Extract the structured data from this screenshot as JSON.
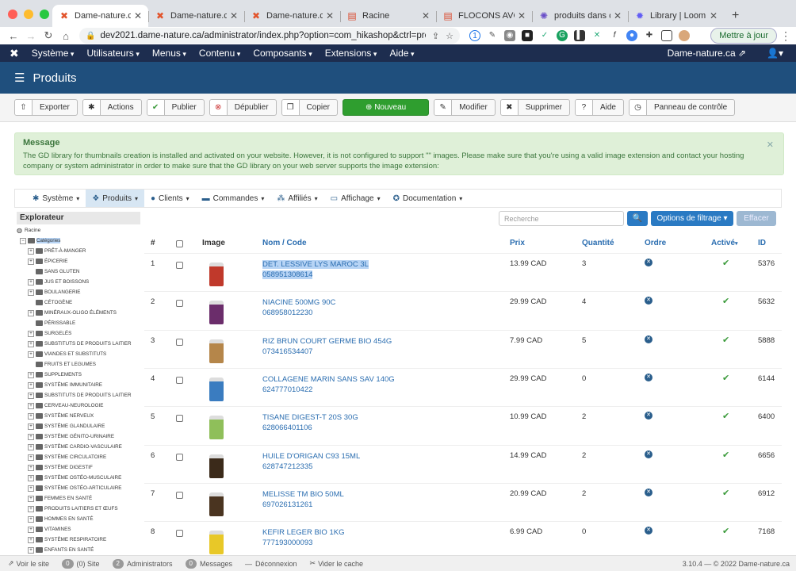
{
  "browser": {
    "tabs": [
      {
        "label": "Dame-nature.ca -",
        "icon": "joomla-icon",
        "active": true
      },
      {
        "label": "Dame-nature.ca -",
        "icon": "joomla-icon",
        "active": false
      },
      {
        "label": "Dame-nature.ca -",
        "icon": "joomla-icon",
        "active": false
      },
      {
        "label": "Racine",
        "icon": "page-icon",
        "active": false
      },
      {
        "label": "FLOCONS AVOINE",
        "icon": "page-icon",
        "active": false
      },
      {
        "label": "produits dans cat",
        "icon": "gear-icon",
        "active": false
      },
      {
        "label": "Library | Loom",
        "icon": "loom-icon",
        "active": false
      }
    ],
    "url": "dev2021.dame-nature.ca/administrator/index.php?option=com_hikashop&ctrl=prod...",
    "update_label": "Mettre à jour"
  },
  "topnav": {
    "items": [
      "Système",
      "Utilisateurs",
      "Menus",
      "Contenu",
      "Composants",
      "Extensions",
      "Aide"
    ],
    "site_link": "Dame-nature.ca ⇗"
  },
  "header": {
    "title": "Produits"
  },
  "toolbar": {
    "export": "Exporter",
    "actions": "Actions",
    "publish": "Publier",
    "unpublish": "Dépublier",
    "copy": "Copier",
    "new": "Nouveau",
    "edit": "Modifier",
    "delete": "Supprimer",
    "help": "Aide",
    "control_panel": "Panneau de contrôle"
  },
  "message": {
    "title": "Message",
    "text": "The GD library for thumbnails creation is installed and activated on your website. However, it is not configured to support \"\" images. Please make sure that you're using a valid image extension and contact your hosting company or system administrator in order to make sure that the GD library on your web server supports the image extension:"
  },
  "submenu": {
    "system": "Système",
    "products": "Produits",
    "clients": "Clients",
    "orders": "Commandes",
    "affiliates": "Affiliés",
    "display": "Affichage",
    "documentation": "Documentation"
  },
  "sidebar": {
    "title": "Explorateur",
    "root": "Racine",
    "categories_label": "Catégories",
    "items": [
      {
        "label": "PRÊT-À-MANGER",
        "expandable": true
      },
      {
        "label": "ÉPICERIE",
        "expandable": true
      },
      {
        "label": "SANS GLUTEN",
        "expandable": false
      },
      {
        "label": "JUS ET BOISSONS",
        "expandable": true
      },
      {
        "label": "BOULANGERIE",
        "expandable": true
      },
      {
        "label": "CÉTOGÈNE",
        "expandable": false
      },
      {
        "label": "MINÉRAUX-OLIGO ÉLÉMENTS",
        "expandable": true
      },
      {
        "label": "PÉRISSABLE",
        "expandable": false
      },
      {
        "label": "SURGELÉS",
        "expandable": true
      },
      {
        "label": "SUBSTITUTS DE PRODUITS LAITIER",
        "expandable": true
      },
      {
        "label": "VIANDES ET SUBSTITUTS",
        "expandable": true
      },
      {
        "label": "FRUITS ET LEGUMES",
        "expandable": false
      },
      {
        "label": "SUPPLEMENTS",
        "expandable": true
      },
      {
        "label": "SYSTÈME IMMUNITAIRE",
        "expandable": true
      },
      {
        "label": "SUBSTITUTS DE PRODUITS LAITIER",
        "expandable": true
      },
      {
        "label": "CERVEAU-NEUROLOGIE",
        "expandable": true
      },
      {
        "label": "SYSTÈME NERVEUX",
        "expandable": true
      },
      {
        "label": "SYSTÈME GLANDULAIRE",
        "expandable": true
      },
      {
        "label": "SYSTÈME GÉNITO-URINAIRE",
        "expandable": true
      },
      {
        "label": "SYSTÈME CARDIO-VASCULAIRE",
        "expandable": true
      },
      {
        "label": "SYSTÈME CIRCULATOIRE",
        "expandable": true
      },
      {
        "label": "SYSTÈME DIGESTIF",
        "expandable": true
      },
      {
        "label": "SYSTÈME OSTÉO-MUSCULAIRE",
        "expandable": true
      },
      {
        "label": "SYSTÈME OSTÉO-ARTICULAIRE",
        "expandable": true
      },
      {
        "label": "FEMMES EN SANTÉ",
        "expandable": true
      },
      {
        "label": "PRODUITS LAITIERS ET ŒUFS",
        "expandable": true
      },
      {
        "label": "HOMMES EN SANTÉ",
        "expandable": true
      },
      {
        "label": "VITAMINES",
        "expandable": true
      },
      {
        "label": "SYSTÈME RESPIRATOIRE",
        "expandable": true
      },
      {
        "label": "ENFANTS EN SANTÉ",
        "expandable": true
      }
    ]
  },
  "search": {
    "placeholder": "Recherche",
    "filter_label": "Options de filtrage",
    "clear_label": "Effacer"
  },
  "table": {
    "headers": {
      "num": "#",
      "image": "Image",
      "name": "Nom / Code",
      "price": "Prix",
      "qty": "Quantité",
      "order": "Ordre",
      "active": "Activé",
      "id": "ID"
    },
    "rows": [
      {
        "num": "1",
        "name": "DET. LESSIVE LYS MAROC 3L",
        "code": "058951308614",
        "price": "13.99 CAD",
        "qty": "3",
        "id": "5376",
        "selected": true,
        "product_color": "#c0392b"
      },
      {
        "num": "2",
        "name": "NIACINE 500MG 90C",
        "code": "068958012230",
        "price": "29.99 CAD",
        "qty": "4",
        "id": "5632",
        "selected": false,
        "product_color": "#6b2d6b"
      },
      {
        "num": "3",
        "name": "RIZ BRUN COURT GERME BIO 454G",
        "code": "073416534407",
        "price": "7.99 CAD",
        "qty": "5",
        "id": "5888",
        "selected": false,
        "product_color": "#b5864a"
      },
      {
        "num": "4",
        "name": "COLLAGENE MARIN SANS SAV 140G",
        "code": "624777010422",
        "price": "29.99 CAD",
        "qty": "0",
        "id": "6144",
        "selected": false,
        "product_color": "#3a7cc0"
      },
      {
        "num": "5",
        "name": "TISANE DIGEST-T 20S 30G",
        "code": "628066401106",
        "price": "10.99 CAD",
        "qty": "2",
        "id": "6400",
        "selected": false,
        "product_color": "#8fbf5a"
      },
      {
        "num": "6",
        "name": "HUILE D'ORIGAN C93 15ML",
        "code": "628747212335",
        "price": "14.99 CAD",
        "qty": "2",
        "id": "6656",
        "selected": false,
        "product_color": "#3b2a1a"
      },
      {
        "num": "7",
        "name": "MELISSE TM BIO 50ML",
        "code": "697026131261",
        "price": "20.99 CAD",
        "qty": "2",
        "id": "6912",
        "selected": false,
        "product_color": "#4a3420"
      },
      {
        "num": "8",
        "name": "KEFIR LEGER BIO 1KG",
        "code": "777193000093",
        "price": "6.99 CAD",
        "qty": "0",
        "id": "7168",
        "selected": false,
        "product_color": "#e8c828"
      }
    ]
  },
  "statusbar": {
    "view_site": "Voir le site",
    "site_count": "0",
    "site_label": "(0) Site",
    "admin_count": "2",
    "admin_label": "Administrators",
    "messages_count": "0",
    "messages_label": "Messages",
    "logout": "Déconnexion",
    "clear_cache": "Vider le cache",
    "version": "3.10.4 — © 2022 Dame-nature.ca"
  }
}
